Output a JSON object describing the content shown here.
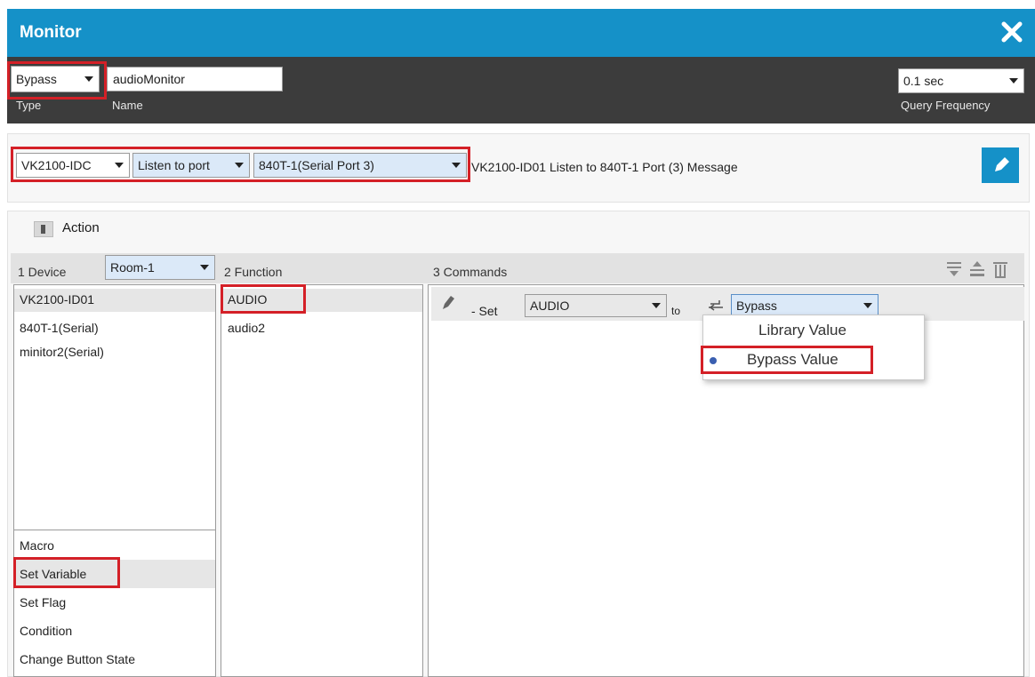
{
  "window": {
    "title": "Monitor"
  },
  "top": {
    "type_value": "Bypass",
    "type_label": "Type",
    "name_value": "audioMonitor",
    "name_label": "Name",
    "query_value": "0.1 sec",
    "query_label": "Query Frequency"
  },
  "filter": {
    "device": "VK2100-IDC",
    "mode": "Listen to port",
    "port": "840T-1(Serial Port 3)",
    "description": "VK2100-ID01 Listen to 840T-1 Port (3) Message"
  },
  "action": {
    "label": "Action",
    "col1_header": "1  Device",
    "room": "Room-1",
    "col2_header": "2  Function",
    "col3_header": "3  Commands",
    "devices": [
      "VK2100-ID01",
      "840T-1(Serial)",
      "minitor2(Serial)"
    ],
    "action_types": [
      "Macro",
      "Set Variable",
      "Set Flag",
      "Condition",
      "Change Button State"
    ],
    "functions": [
      "AUDIO",
      "audio2"
    ]
  },
  "command": {
    "set_label": "- Set",
    "variable": "AUDIO",
    "to_label": "to",
    "value": "Bypass",
    "options": [
      "Library Value",
      "Bypass Value"
    ],
    "selected_option": "Bypass Value"
  },
  "colors": {
    "accent": "#1591c8",
    "highlight": "#d42027",
    "toolbar": "#3c3c3c"
  },
  "icons": [
    "close-icon",
    "edit-icon",
    "toggle-icon",
    "pencil-icon",
    "swap-icon",
    "add-command-icon",
    "export-icon",
    "delete-icon",
    "chevron-down-icon",
    "radio-dot-icon"
  ]
}
